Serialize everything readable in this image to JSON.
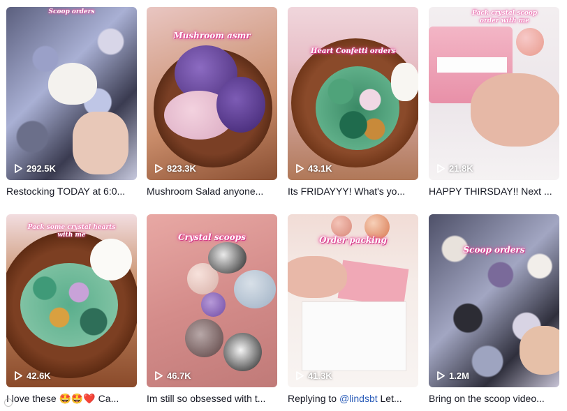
{
  "videos": [
    {
      "overlay": "Scoop orders",
      "views": "292.5K",
      "caption": "Restocking TODAY at 6:0..."
    },
    {
      "overlay": "Mushroom asmr",
      "views": "823.3K",
      "caption": "Mushroom Salad anyone..."
    },
    {
      "overlay": "Heart Confetti orders",
      "views": "43.1K",
      "caption": "Its FRIDAYYY! What's yo..."
    },
    {
      "overlay": "Pack crystal scoop order with me",
      "views": "21.8K",
      "caption": "HAPPY THIRSDAY!! Next ..."
    },
    {
      "overlay": "Pack some crystal hearts with me",
      "views": "42.6K",
      "caption": "I love these 🤩🤩❤️ Ca..."
    },
    {
      "overlay": "Crystal scoops",
      "views": "46.7K",
      "caption": "Im still so obsessed with t..."
    },
    {
      "overlay": "Order packing",
      "views": "41.3K",
      "caption_prefix": "Replying to ",
      "caption_mention": "@lindsbt",
      "caption_suffix": " Let..."
    },
    {
      "overlay": "Scoop orders",
      "views": "1.2M",
      "caption": "Bring on the scoop video..."
    }
  ],
  "icons": {
    "play": "play-icon"
  },
  "colors": {
    "caption_text": "#161823",
    "mention": "#2b5db9",
    "overlay_glow": "#e8449a"
  }
}
